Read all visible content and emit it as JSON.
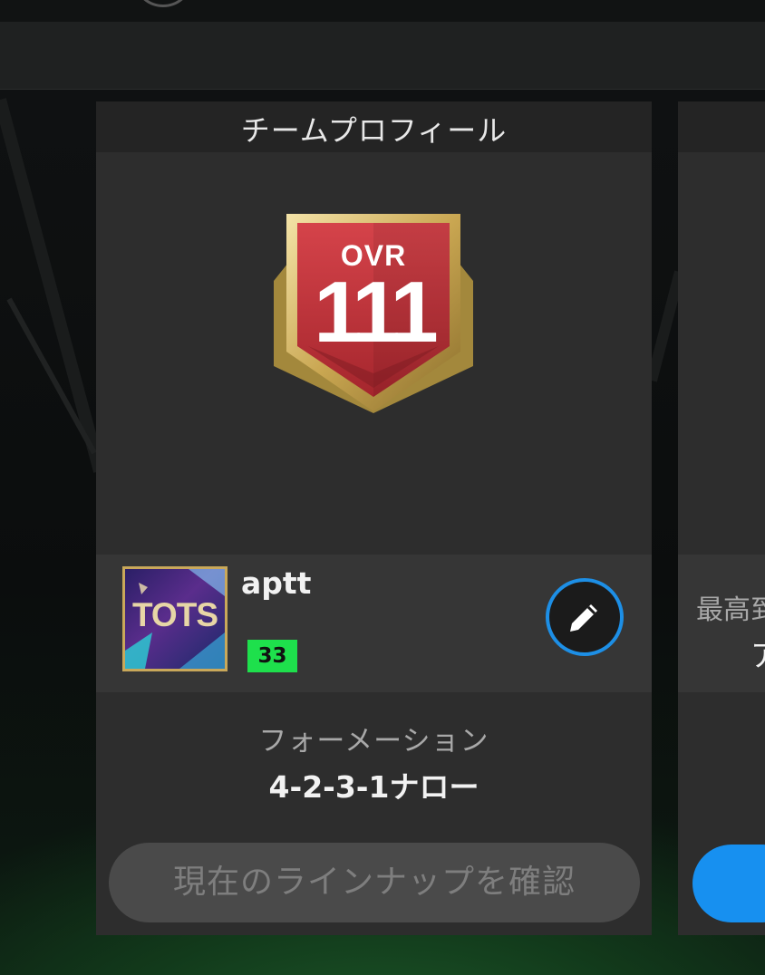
{
  "card": {
    "title": "チームプロフィール",
    "badge": {
      "label": "OVR",
      "value": "111"
    },
    "profile": {
      "avatar_text": "TOTS",
      "username": "aptt",
      "level": "33"
    },
    "formation": {
      "label": "フォーメーション",
      "value": "4-2-3-1ナロー"
    },
    "lineup_button": "現在のラインナップを確認"
  },
  "side_card": {
    "label": "最高到",
    "value": "ア"
  },
  "colors": {
    "accent_blue": "#1d8fe6",
    "level_green": "#1ee04c",
    "badge_red": "#c0343a",
    "badge_gold": "#d8c07a"
  }
}
